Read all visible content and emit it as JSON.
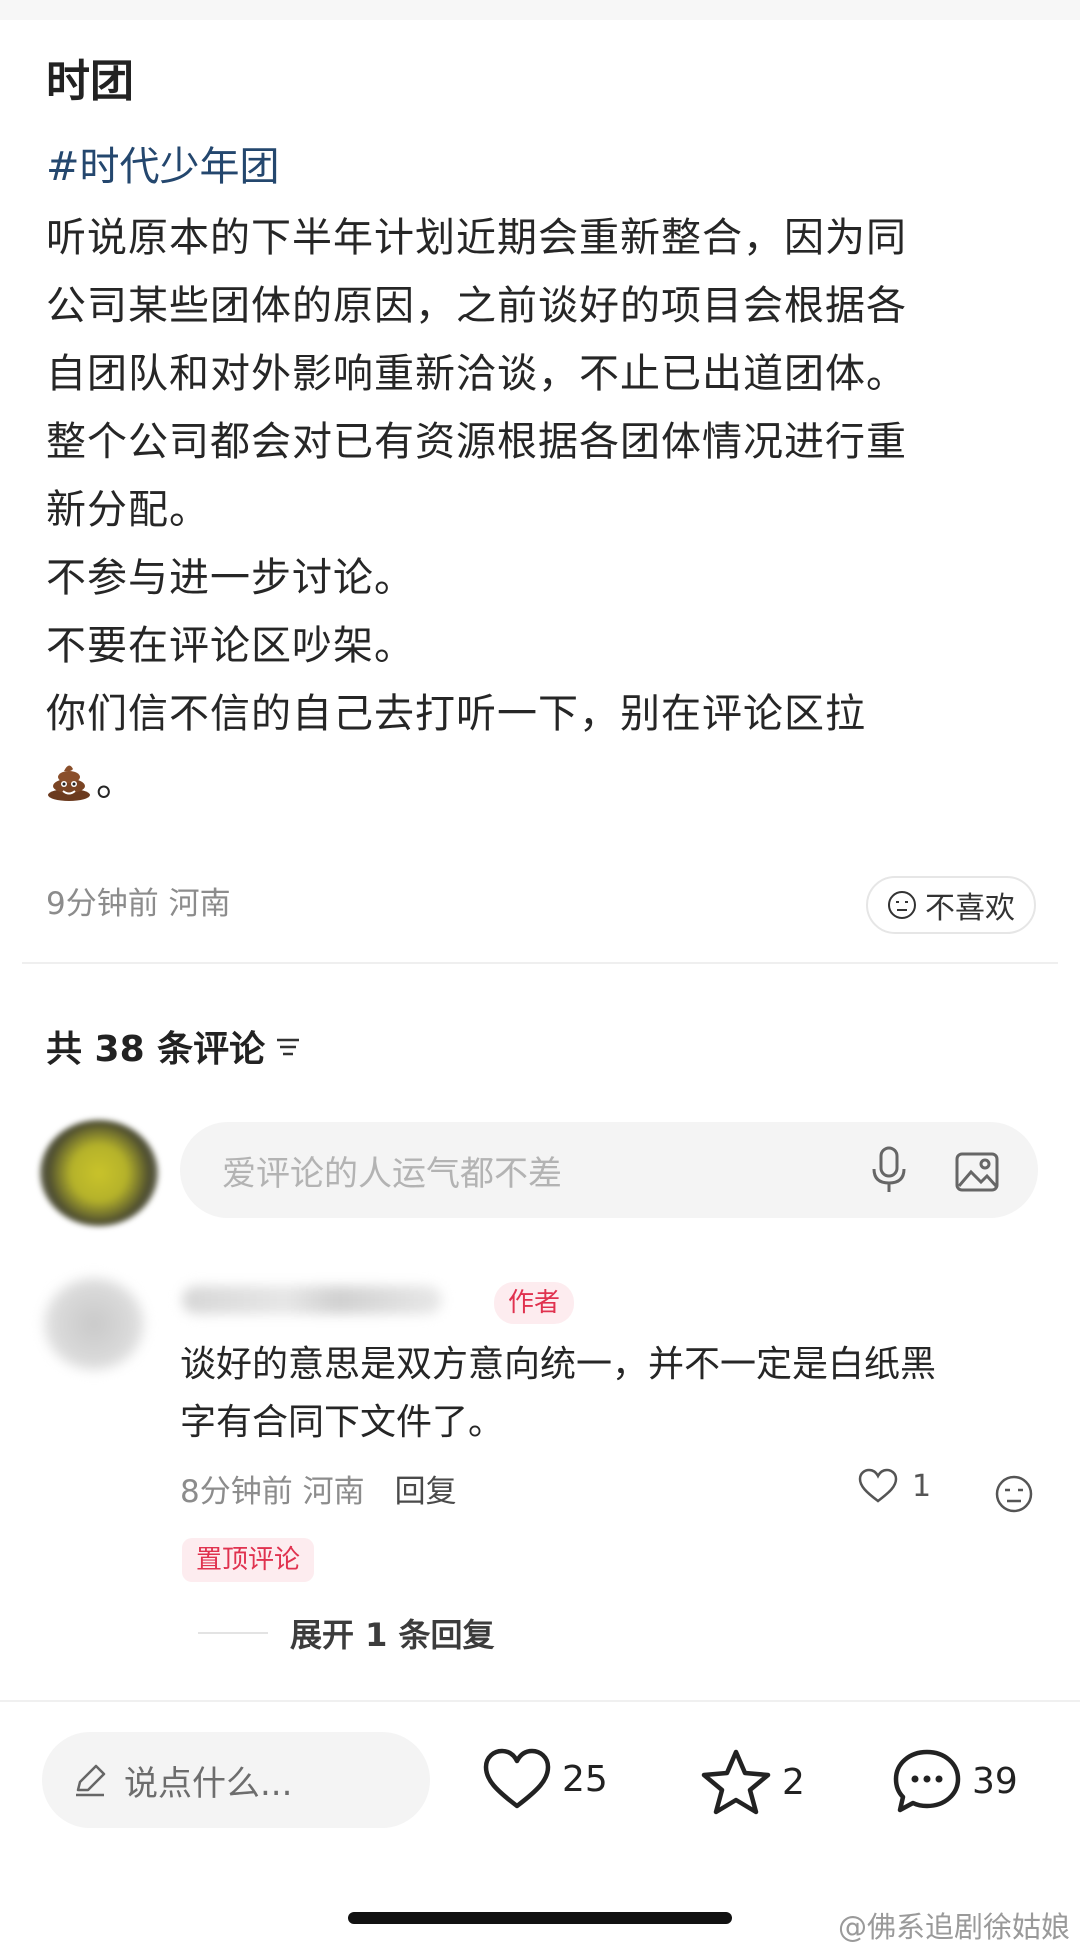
{
  "post": {
    "title": "时团",
    "hashtag": "#时代少年团",
    "lines": [
      "听说原本的下半年计划近期会重新整合，因为同",
      "公司某些团体的原因，之前谈好的项目会根据各",
      "自团队和对外影响重新洽谈，不止已出道团体。",
      "整个公司都会对已有资源根据各团体情况进行重",
      "新分配。",
      "不参与进一步讨论。",
      "不要在评论区吵架。",
      "你们信不信的自己去打听一下，别在评论区拉"
    ],
    "last_line_suffix": "。",
    "meta": "9分钟前 河南",
    "dislike_label": "不喜欢"
  },
  "comments": {
    "header": "共 38 条评论",
    "input_placeholder": "爱评论的人运气都不差",
    "items": [
      {
        "author_badge": "作者",
        "lines": [
          "谈好的意思是双方意向统一，并不一定是白纸黑",
          "字有合同下文件了。"
        ],
        "time_location": "8分钟前 河南",
        "reply_label": "回复",
        "likes": "1",
        "pinned_label": "置顶评论",
        "expand_label": "展开 1 条回复"
      }
    ]
  },
  "bottom_bar": {
    "input_placeholder": "说点什么...",
    "likes": "25",
    "favorites": "2",
    "comments": "39"
  },
  "watermark": "@佛系追剧徐姑娘",
  "colors": {
    "hashtag": "#24476e",
    "badge_text": "#e0324f",
    "badge_bg": "#fdecef",
    "meta_gray": "#8c8c8c"
  }
}
